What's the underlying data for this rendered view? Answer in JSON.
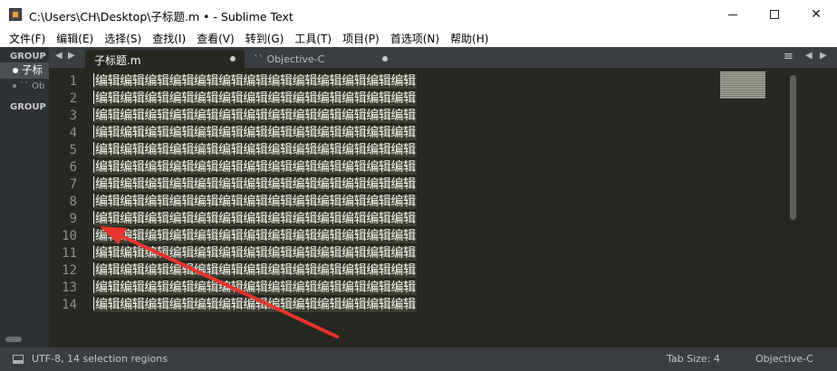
{
  "window": {
    "title": "C:\\Users\\CH\\Desktop\\子标题.m • - Sublime Text",
    "icon": "sublime-text-icon"
  },
  "menu": [
    "文件(F)",
    "编辑(E)",
    "选择(S)",
    "查找(I)",
    "查看(V)",
    "转到(G)",
    "工具(T)",
    "项目(P)",
    "首选项(N)",
    "帮助(H)"
  ],
  "sidebar": {
    "groups": [
      {
        "title": "GROUP",
        "files": [
          {
            "label": "子标",
            "active": true
          },
          {
            "label": "`` Ob",
            "active": false
          }
        ]
      },
      {
        "title": "GROUP",
        "files": []
      }
    ]
  },
  "tabs": {
    "prev_arrow": "◀",
    "next_arrow": "▶",
    "items": [
      {
        "label": "子标题.m",
        "active": true,
        "dirty": true
      },
      {
        "label": "`` Objective-C",
        "active": false,
        "dirty": true
      }
    ],
    "menu_icon": "≡"
  },
  "editor": {
    "line_numbers": [
      "1",
      "2",
      "3",
      "4",
      "5",
      "6",
      "7",
      "8",
      "9",
      "10",
      "11",
      "12",
      "13",
      "14"
    ],
    "line_text": "编辑编辑编辑编辑编辑编辑编辑编辑编辑编辑编辑编辑编辑",
    "selection_regions": 14,
    "colors": {
      "background": "#272822",
      "text": "#f8f8f2",
      "gutter": "#8f908a",
      "annotation_arrow": "#e8342c"
    }
  },
  "status": {
    "left": "UTF-8, 14 selection regions",
    "tab_size": "Tab Size: 4",
    "syntax": "Objective-C"
  }
}
